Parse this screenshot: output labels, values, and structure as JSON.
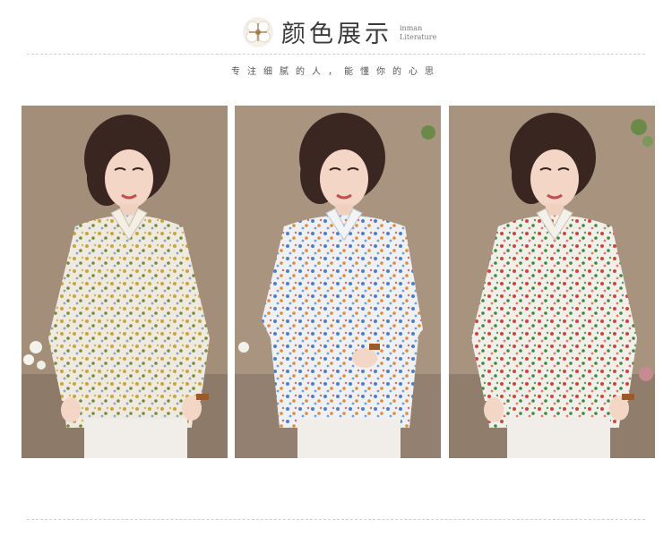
{
  "header": {
    "title": "颜色展示",
    "brand_line1": "inman",
    "brand_line2": "Literature",
    "logo_icon": "cotton-flower-icon"
  },
  "tagline": "专注细腻的人，能懂你的心思",
  "photos": [
    {
      "variant": "yellow-floral",
      "accent": "#c9a53c",
      "accent2": "#7a8a3a"
    },
    {
      "variant": "blue-floral",
      "accent": "#4d7fc8",
      "accent2": "#e08a3a"
    },
    {
      "variant": "red-green-floral",
      "accent": "#d0453a",
      "accent2": "#3e8a3e"
    }
  ]
}
